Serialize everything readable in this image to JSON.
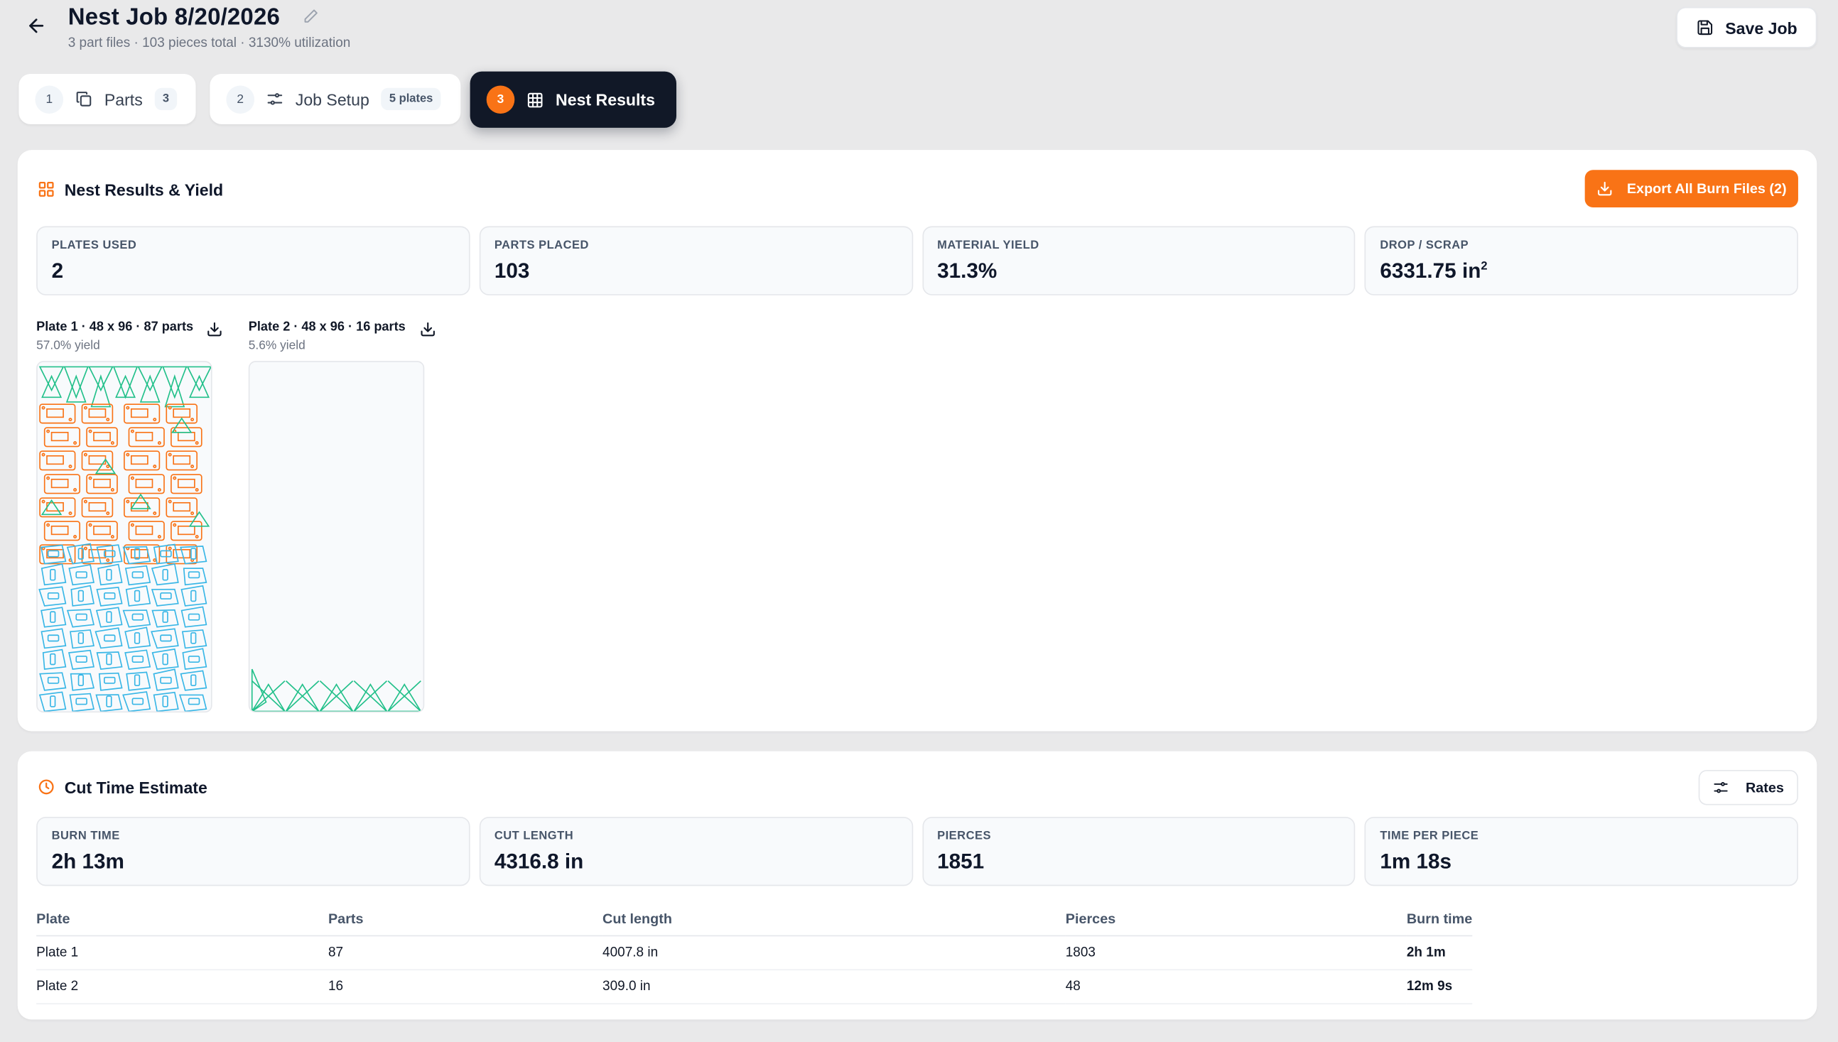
{
  "header": {
    "title": "Nest Job 8/20/2026",
    "subtitle": "3 part files · 103 pieces total · 3130% utilization",
    "save_label": "Save Job"
  },
  "tabs": [
    {
      "num": "1",
      "label": "Parts",
      "badge": "3"
    },
    {
      "num": "2",
      "label": "Job Setup",
      "badge": "5 plates"
    },
    {
      "num": "3",
      "label": "Nest Results"
    }
  ],
  "nest": {
    "title": "Nest Results & Yield",
    "export_label": "Export All Burn Files (2)",
    "stats": [
      {
        "label": "PLATES USED",
        "value": "2"
      },
      {
        "label": "PARTS PLACED",
        "value": "103"
      },
      {
        "label": "MATERIAL YIELD",
        "value": "31.3%"
      },
      {
        "label": "DROP / SCRAP",
        "value": "6331.75 in",
        "sup": "2"
      }
    ],
    "plates": [
      {
        "title": "Plate 1 · 48 x 96 · 87 parts",
        "yield": "57.0% yield",
        "yield_fraction": 0.57
      },
      {
        "title": "Plate 2 · 48 x 96 · 16 parts",
        "yield": "5.6% yield",
        "yield_fraction": 0.056
      }
    ]
  },
  "cut": {
    "title": "Cut Time Estimate",
    "rates_label": "Rates",
    "stats": [
      {
        "label": "BURN TIME",
        "value": "2h 13m"
      },
      {
        "label": "CUT LENGTH",
        "value": "4316.8 in"
      },
      {
        "label": "PIERCES",
        "value": "1851"
      },
      {
        "label": "TIME PER PIECE",
        "value": "1m 18s"
      }
    ],
    "table": {
      "headers": [
        "Plate",
        "Parts",
        "Cut length",
        "Pierces",
        "Burn time"
      ],
      "rows": [
        [
          "Plate 1",
          "87",
          "4007.8 in",
          "1803",
          "2h 1m"
        ],
        [
          "Plate 2",
          "16",
          "309.0 in",
          "48",
          "12m 9s"
        ]
      ]
    }
  },
  "colors": {
    "accent": "#f97316",
    "dark": "#111827",
    "part_green": "#22c08a",
    "part_orange": "#f97316",
    "part_blue": "#38b6e6"
  },
  "icons": [
    "arrow-left-icon",
    "pencil-icon",
    "save-icon",
    "copy-icon",
    "sliders-icon",
    "grid-icon",
    "layout-grid-icon",
    "download-icon",
    "clock-icon"
  ]
}
